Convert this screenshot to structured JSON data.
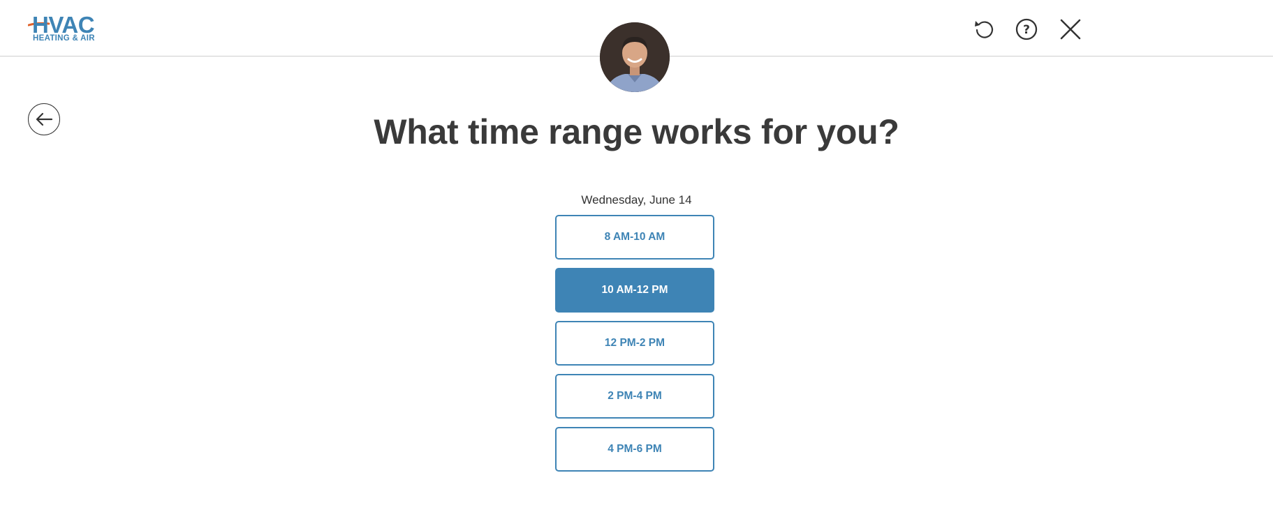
{
  "brand": {
    "logo_main": "HVAC",
    "logo_sub": "HEATING & AIR",
    "accent_color": "#3e84b5",
    "swoosh_color": "#e0622b"
  },
  "header": {
    "actions": [
      {
        "name": "restart",
        "icon": "refresh-icon"
      },
      {
        "name": "help",
        "icon": "help-circle-icon"
      },
      {
        "name": "close",
        "icon": "close-icon"
      }
    ]
  },
  "avatar": {
    "icon": "technician-avatar"
  },
  "back": {
    "icon": "arrow-left-icon"
  },
  "title": "What time range works for you?",
  "date_label": "Wednesday, June 14",
  "time_slots": [
    {
      "label": "8 AM-10 AM",
      "selected": false
    },
    {
      "label": "10 AM-12 PM",
      "selected": true
    },
    {
      "label": "12 PM-2 PM",
      "selected": false
    },
    {
      "label": "2 PM-4 PM",
      "selected": false
    },
    {
      "label": "4 PM-6 PM",
      "selected": false
    }
  ]
}
